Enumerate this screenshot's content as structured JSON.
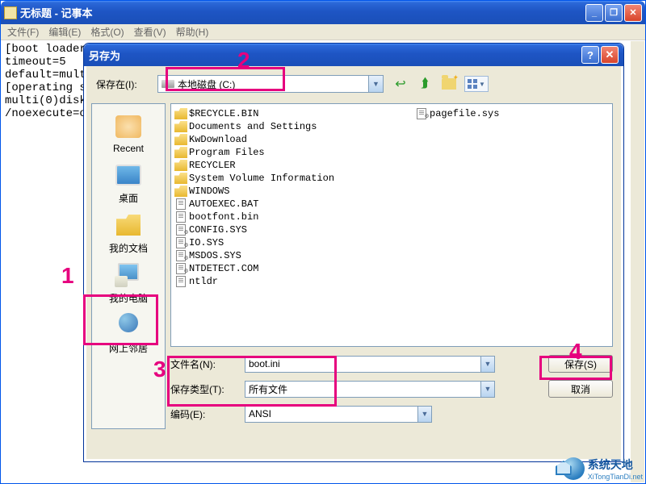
{
  "notepad": {
    "title": "无标题 - 记事本",
    "menu": {
      "file": "文件(F)",
      "edit": "编辑(E)",
      "format": "格式(O)",
      "view": "查看(V)",
      "help": "帮助(H)"
    },
    "content": "[boot loader]\ntimeout=5\ndefault=multi(0)disk(0)rdisk(0)partition(1)\\WINDOWS\n[operating systems]\nmulti(0)disk(0)rdisk(0)partition(1)\\WINDOWS=\"Microsoft Windows XP Professional\"\n/noexecute=optin /fastdetect"
  },
  "saveas": {
    "title": "另存为",
    "savein_label": "保存在(I):",
    "savein_value": "本地磁盘 (C:)",
    "places": {
      "recent": "Recent",
      "desktop": "桌面",
      "mydocs": "我的文档",
      "mycomputer": "我的电脑",
      "network": "网上邻居"
    },
    "files": {
      "col1": [
        {
          "t": "folder",
          "n": "$RECYCLE.BIN"
        },
        {
          "t": "folder",
          "n": "Documents and Settings"
        },
        {
          "t": "folder",
          "n": "KwDownload"
        },
        {
          "t": "folder",
          "n": "Program Files"
        },
        {
          "t": "folder",
          "n": "RECYCLER"
        },
        {
          "t": "folder",
          "n": "System Volume Information"
        },
        {
          "t": "folder",
          "n": "WINDOWS"
        },
        {
          "t": "file",
          "n": "AUTOEXEC.BAT"
        },
        {
          "t": "file",
          "n": "bootfont.bin"
        },
        {
          "t": "sys",
          "n": "CONFIG.SYS"
        },
        {
          "t": "sys",
          "n": "IO.SYS"
        },
        {
          "t": "sys",
          "n": "MSDOS.SYS"
        },
        {
          "t": "sys",
          "n": "NTDETECT.COM"
        },
        {
          "t": "file",
          "n": "ntldr"
        }
      ],
      "col2": [
        {
          "t": "sys",
          "n": "pagefile.sys"
        }
      ]
    },
    "filename_label": "文件名(N):",
    "filename_value": "boot.ini",
    "filetype_label": "保存类型(T):",
    "filetype_value": "所有文件",
    "encoding_label": "编码(E):",
    "encoding_value": "ANSI",
    "save_btn": "保存(S)",
    "cancel_btn": "取消"
  },
  "annotations": {
    "n1": "1",
    "n2": "2",
    "n3": "3",
    "n4": "4"
  },
  "watermark": {
    "line1": "系统天地",
    "line2": "XiTongTianDi.net"
  }
}
